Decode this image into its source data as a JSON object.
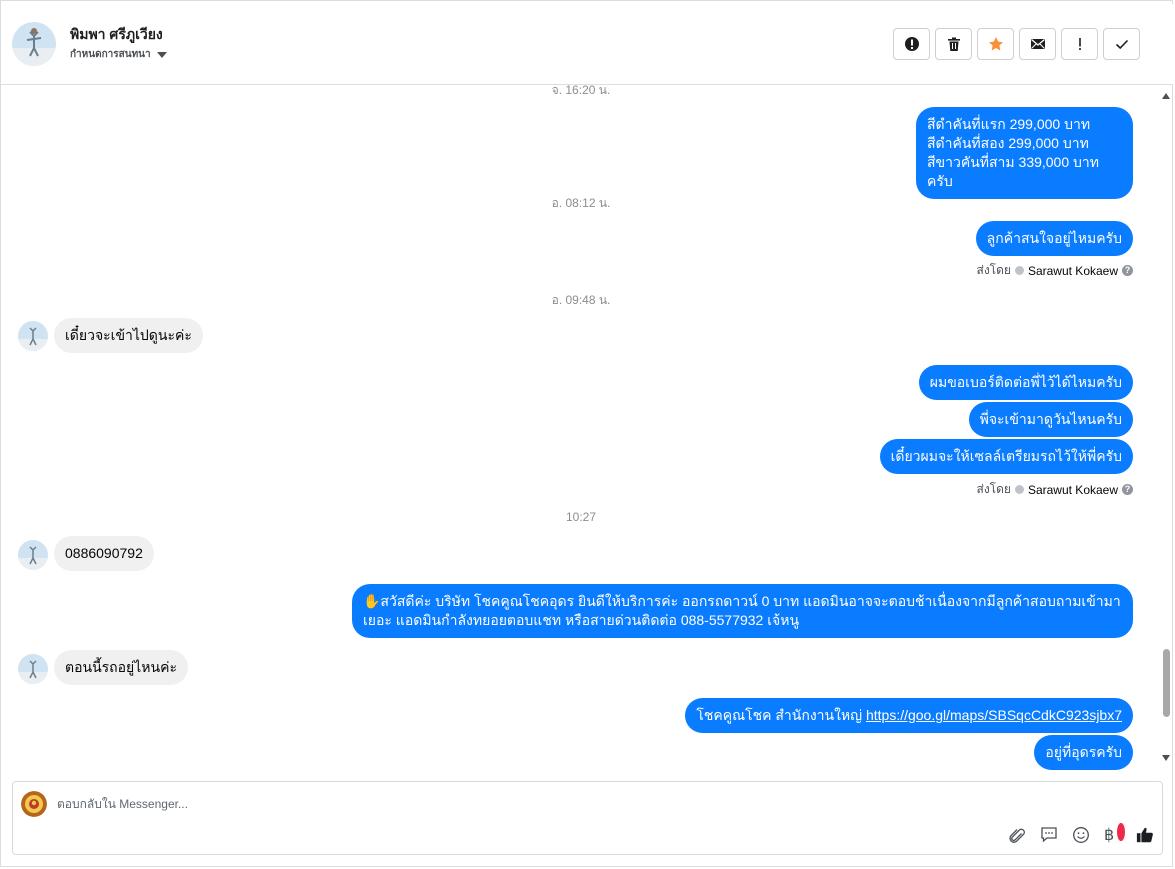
{
  "header": {
    "contact_name": "พิมพา ศรีภูเวียง",
    "sub_label": "กำหนดการสนทนา",
    "icons": [
      "alert-circle-icon",
      "trash-icon",
      "star-icon",
      "envelope-icon",
      "exclamation-icon",
      "check-icon"
    ]
  },
  "chat": {
    "timestamps": [
      "จ. 16:20 น.",
      "อ. 08:12 น.",
      "อ. 09:48 น.",
      "10:27"
    ],
    "m1_line1": "สีดำคันที่แรก 299,000 บาท",
    "m1_line2": "สีดำคันที่สอง 299,000 บาท",
    "m1_line3": "สีขาวคันที่สาม 339,000 บาท ครับ",
    "m2": "ลูกค้าสนใจอยู่ไหมครับ",
    "sent_by_label": "ส่งโดย",
    "sent_by_name": "Sarawut Kokaew",
    "in1": "เดี๋ยวจะเข้าไปดูนะค่ะ",
    "m3": "ผมขอเบอร์ติดต่อพี่ไว้ได้ไหมครับ",
    "m4": "พี่จะเข้ามาดูวันไหนครับ",
    "m5": "เดี๋ยวผมจะให้เซลล์เตรียมรถไว้ให้พี่ครับ",
    "in2": "0886090792",
    "m6_line1": "✋สวัสดีค่ะ บริษัท โชคคูณโชคอุดร ยินดีให้บริการค่ะ ออกรถดาวน์ 0 บาท แอดมินอาจจะตอบช้าเนื่องจากมีลูกค้าสอบถามเข้ามา",
    "m6_line2": "เยอะ แอดมินกำลังทยอยตอบแชท หรือสายด่วนติดต่อ 088-5577932 เจ้หนู",
    "in3": "ตอนนี้รถอยู่ไหนค่ะ",
    "m7_text": "โชคคูณโชค สำนักงานใหญ่ ",
    "m7_link": "https://goo.gl/maps/SBSqcCdkC923sjbx7",
    "m8": "อยู่ที่อุดรครับ"
  },
  "composer": {
    "placeholder": "ตอบกลับใน Messenger...",
    "baht_symbol": "฿",
    "icons": [
      "paperclip-icon",
      "saved-replies-icon",
      "emoji-icon",
      "payment-icon",
      "like-icon"
    ]
  },
  "colors": {
    "accent": "#0a7cff",
    "incoming_bg": "#f0f0f0",
    "star": "#f7923b"
  }
}
